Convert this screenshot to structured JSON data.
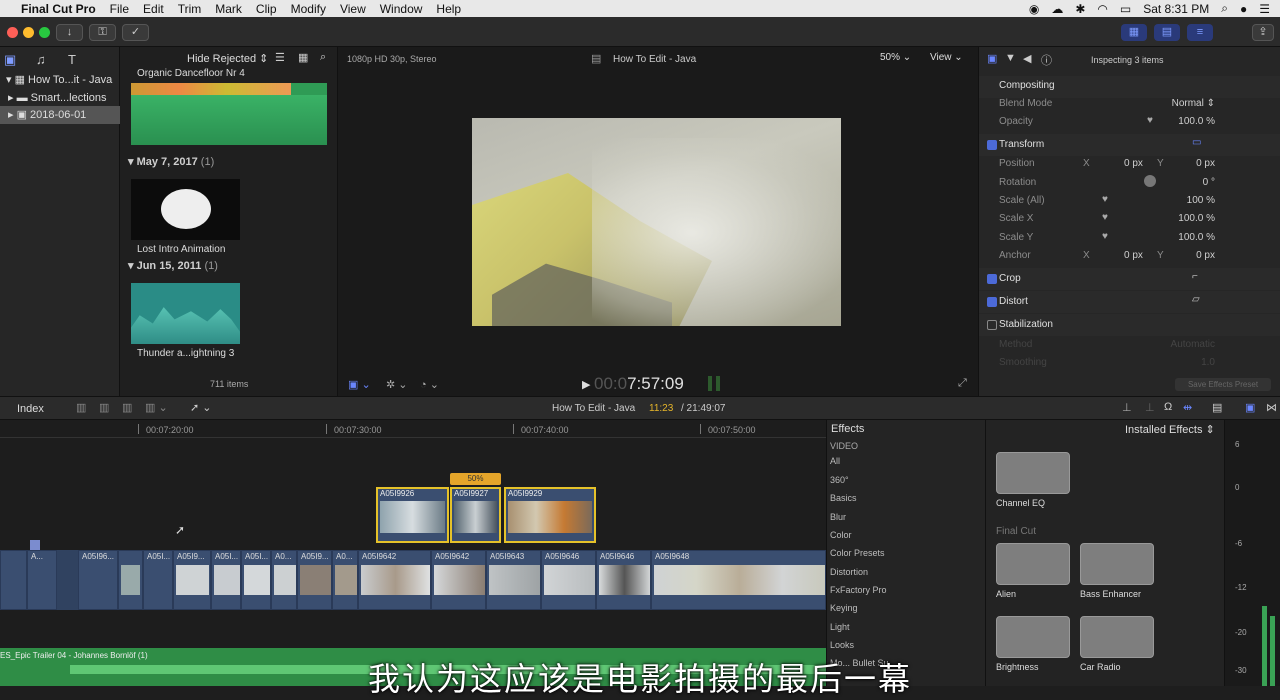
{
  "menubar": {
    "app": "Final Cut Pro",
    "items": [
      "File",
      "Edit",
      "Trim",
      "Mark",
      "Clip",
      "Modify",
      "View",
      "Window",
      "Help"
    ],
    "clock": "Sat 8:31 PM"
  },
  "libraries": {
    "items": [
      {
        "label": "How To...it - Java"
      },
      {
        "label": "Smart...lections"
      },
      {
        "label": "2018-06-01"
      }
    ]
  },
  "browser": {
    "filter": "Hide Rejected",
    "top_clip": "Organic Dancefloor Nr 4",
    "groups": [
      {
        "date": "May 7, 2017",
        "count": "(1)",
        "clip": "Lost Intro Animation"
      },
      {
        "date": "Jun 15, 2011",
        "count": "(1)",
        "clip": "Thunder a...ightning 3"
      }
    ],
    "item_count": "711 items"
  },
  "viewer": {
    "format": "1080p HD 30p, Stereo",
    "title": "How To Edit - Java",
    "zoom": "50%",
    "view": "View",
    "timecode_dim": "00:0",
    "timecode": "7:57:09"
  },
  "inspector": {
    "title": "Inspecting 3 items",
    "compositing": "Compositing",
    "blend_mode_label": "Blend Mode",
    "blend_mode_value": "Normal",
    "opacity_label": "Opacity",
    "opacity_value": "100.0 %",
    "transform": "Transform",
    "position_label": "Position",
    "position_x": "0 px",
    "position_y": "0 px",
    "rotation_label": "Rotation",
    "rotation_value": "0 °",
    "scale_all_label": "Scale (All)",
    "scale_all_value": "100 %",
    "scale_x_label": "Scale X",
    "scale_x_value": "100.0 %",
    "scale_y_label": "Scale Y",
    "scale_y_value": "100.0 %",
    "anchor_label": "Anchor",
    "anchor_x": "0 px",
    "anchor_y": "0 px",
    "x": "X",
    "y": "Y",
    "crop": "Crop",
    "distort": "Distort",
    "stabilization": "Stabilization",
    "method_label": "Method",
    "method_value": "Automatic",
    "smoothing_label": "Smoothing",
    "smoothing_value": "1.0",
    "save_preset": "Save Effects Preset"
  },
  "timeline_bar": {
    "index": "Index",
    "project": "How To Edit - Java",
    "position": "11:23",
    "duration": "/ 21:49:07"
  },
  "timeline": {
    "ruler": [
      "00:07:20:00",
      "00:07:30:00",
      "00:07:40:00",
      "00:07:50:00"
    ],
    "connected": [
      {
        "name": "A05I9926"
      },
      {
        "name": "A05I9927",
        "badge": "50%"
      },
      {
        "name": "A05I9929"
      }
    ],
    "primary": [
      "A...",
      "A05I96...",
      "A05I...",
      "A05I9...",
      "A05I...",
      "A05I...",
      "A0...",
      "A05I9...",
      "A0...",
      "A05I9642",
      "A05I9642",
      "A05I9643",
      "A05I9646",
      "A05I9646",
      "A05I9648"
    ],
    "audio_clip": "ES_Epic Trailer 04 - Johannes Bornlöf (1)"
  },
  "effects": {
    "title": "Effects",
    "installed": "Installed Effects",
    "categories": [
      "VIDEO",
      "All",
      "360°",
      "Basics",
      "Blur",
      "Color",
      "Color Presets",
      "Distortion",
      "FxFactory Pro",
      "Keying",
      "Light",
      "Looks",
      "Mo... Bullet Su..."
    ],
    "group_label": "Final Cut",
    "tiles": [
      "Channel EQ",
      "Alien",
      "Bass Enhancer",
      "Brightness",
      "Car Radio"
    ]
  },
  "meters": {
    "ticks": [
      "6",
      "0",
      "-6",
      "-12",
      "-20",
      "-30"
    ]
  },
  "subtitle": "我认为这应该是电影拍摄的最后一幕"
}
